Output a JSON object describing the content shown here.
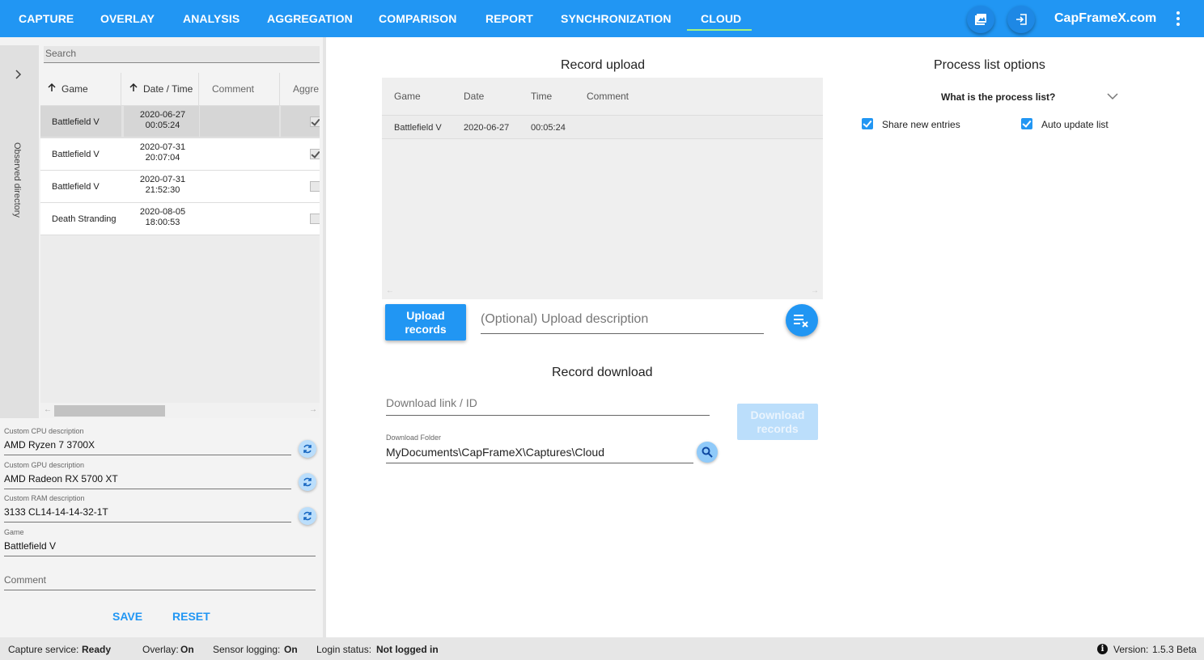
{
  "nav": {
    "items": [
      "CAPTURE",
      "OVERLAY",
      "ANALYSIS",
      "AGGREGATION",
      "COMPARISON",
      "REPORT",
      "SYNCHRONIZATION",
      "CLOUD"
    ],
    "active": "CLOUD",
    "brand": "CapFrameX.com",
    "accent": "#2196f3",
    "active_underline": "#a5f37d",
    "icons": [
      "screenshot-icon",
      "login-icon",
      "more-vert-icon"
    ]
  },
  "sidebar": {
    "rail_label": "Observed directory",
    "search_placeholder": "Search",
    "columns": [
      "Game",
      "Date / Time",
      "Comment",
      "Aggre"
    ],
    "rows": [
      {
        "game": "Battlefield V",
        "date": "2020-06-27",
        "time": "00:05:24",
        "checked": true,
        "selected": true
      },
      {
        "game": "Battlefield V",
        "date": "2020-07-31",
        "time": "20:07:04",
        "checked": true,
        "selected": false
      },
      {
        "game": "Battlefield V",
        "date": "2020-07-31",
        "time": "21:52:30",
        "checked": false,
        "selected": false
      },
      {
        "game": "Death Stranding",
        "date": "2020-08-05",
        "time": "18:00:53",
        "checked": false,
        "selected": false
      }
    ]
  },
  "details": {
    "cpu_label": "Custom CPU description",
    "cpu_value": "AMD Ryzen 7 3700X",
    "gpu_label": "Custom GPU description",
    "gpu_value": "AMD Radeon RX 5700 XT",
    "ram_label": "Custom RAM description",
    "ram_value": "3133 CL14-14-14-32-1T",
    "game_label": "Game",
    "game_value": "Battlefield V",
    "comment_placeholder": "Comment",
    "save_label": "SAVE",
    "reset_label": "RESET"
  },
  "upload": {
    "title": "Record upload",
    "columns": [
      "Game",
      "Date",
      "Time",
      "Comment"
    ],
    "rows": [
      {
        "game": "Battlefield V",
        "date": "2020-06-27",
        "time": "00:05:24",
        "comment": ""
      }
    ],
    "button_label": "Upload records",
    "description_placeholder": "(Optional) Upload description"
  },
  "download": {
    "title": "Record download",
    "link_placeholder": "Download link / ID",
    "folder_label": "Download Folder",
    "folder_value": "MyDocuments\\CapFrameX\\Captures\\Cloud",
    "button_label": "Download records"
  },
  "process_list": {
    "title": "Process list options",
    "expander_label": "What is the process list?",
    "share_label": "Share new entries",
    "share_checked": true,
    "auto_update_label": "Auto update list",
    "auto_update_checked": true
  },
  "status": {
    "capture_label": "Capture service:",
    "capture_value": "Ready",
    "overlay_label": "Overlay:",
    "overlay_value": "On",
    "sensor_label": "Sensor logging:",
    "sensor_value": "On",
    "login_label": "Login status:",
    "login_value": "Not logged in",
    "version_label": "Version:",
    "version_value": "1.5.3 Beta"
  }
}
